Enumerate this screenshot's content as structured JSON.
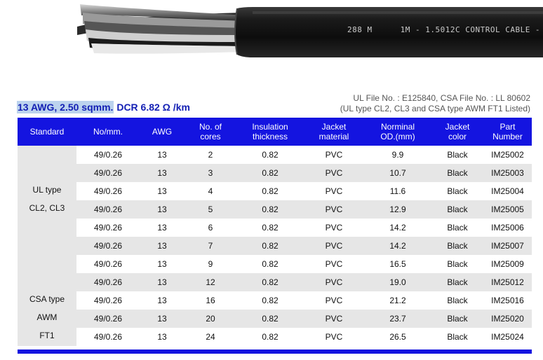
{
  "cable_print": {
    "left": "288 M",
    "right": "1M - 1.5012C CONTROL CABLE -"
  },
  "headline": {
    "highlighted": "13 AWG, 2.50 sqmm.",
    "rest": " DCR 6.82 Ω /km"
  },
  "file_info": {
    "line1": "UL File No. : E125840, CSA File No. : LL 80602",
    "line2": "(UL type CL2, CL3 and CSA type AWM FT1 Listed)"
  },
  "table": {
    "headers": [
      [
        "Standard"
      ],
      [
        "No/mm."
      ],
      [
        "AWG"
      ],
      [
        "No. of",
        "cores"
      ],
      [
        "Insulation",
        "thickness"
      ],
      [
        "Jacket",
        "material"
      ],
      [
        "Norminal",
        "OD.(mm)"
      ],
      [
        "Jacket",
        "color"
      ],
      [
        "Part",
        "Number"
      ]
    ],
    "standard_labels": [
      "UL type",
      "CL2, CL3",
      "CSA type",
      "AWM",
      "FT1"
    ],
    "rows": [
      [
        "49/0.26",
        "13",
        "2",
        "0.82",
        "PVC",
        "9.9",
        "Black",
        "IM25002"
      ],
      [
        "49/0.26",
        "13",
        "3",
        "0.82",
        "PVC",
        "10.7",
        "Black",
        "IM25003"
      ],
      [
        "49/0.26",
        "13",
        "4",
        "0.82",
        "PVC",
        "11.6",
        "Black",
        "IM25004"
      ],
      [
        "49/0.26",
        "13",
        "5",
        "0.82",
        "PVC",
        "12.9",
        "Black",
        "IM25005"
      ],
      [
        "49/0.26",
        "13",
        "6",
        "0.82",
        "PVC",
        "14.2",
        "Black",
        "IM25006"
      ],
      [
        "49/0.26",
        "13",
        "7",
        "0.82",
        "PVC",
        "14.2",
        "Black",
        "IM25007"
      ],
      [
        "49/0.26",
        "13",
        "9",
        "0.82",
        "PVC",
        "16.5",
        "Black",
        "IM25009"
      ],
      [
        "49/0.26",
        "13",
        "12",
        "0.82",
        "PVC",
        "19.0",
        "Black",
        "IM25012"
      ],
      [
        "49/0.26",
        "13",
        "16",
        "0.82",
        "PVC",
        "21.2",
        "Black",
        "IM25016"
      ],
      [
        "49/0.26",
        "13",
        "20",
        "0.82",
        "PVC",
        "23.7",
        "Black",
        "IM25020"
      ],
      [
        "49/0.26",
        "13",
        "24",
        "0.82",
        "PVC",
        "26.5",
        "Black",
        "IM25024"
      ]
    ]
  },
  "colors": {
    "header_blue": "#1414e0",
    "title_blue": "#1420b4",
    "highlight": "#bcd3ee",
    "row_shade": "#e6e6e6"
  }
}
